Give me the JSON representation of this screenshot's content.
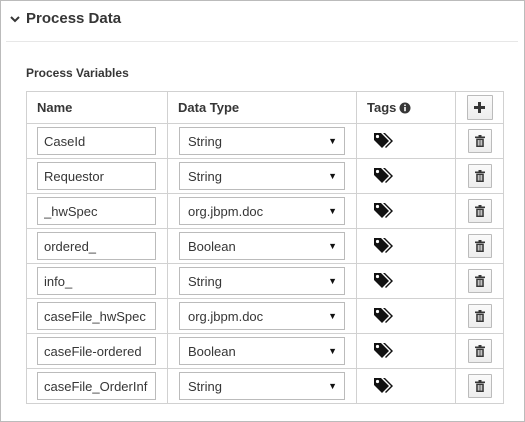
{
  "section": {
    "title": "Process Data",
    "icon": "chevron-down-icon"
  },
  "subsection": {
    "title": "Process Variables"
  },
  "table": {
    "headers": {
      "name": "Name",
      "data_type": "Data Type",
      "tags": "Tags"
    },
    "rows": [
      {
        "name": "CaseId",
        "type": "String"
      },
      {
        "name": "Requestor",
        "type": "String"
      },
      {
        "name": "_hwSpec",
        "type": "org.jbpm.doc"
      },
      {
        "name": "ordered_",
        "type": "Boolean"
      },
      {
        "name": "info_",
        "type": "String"
      },
      {
        "name": "caseFile_hwSpec",
        "type": "org.jbpm.doc"
      },
      {
        "name": "caseFile-ordered",
        "type": "Boolean"
      },
      {
        "name": "caseFile_OrderInf",
        "type": "String"
      }
    ]
  },
  "icons": {
    "info": "info-circle-icon",
    "add": "plus-icon",
    "tag": "tags-icon",
    "delete": "trash-icon",
    "dropdown": "caret-down-icon"
  }
}
